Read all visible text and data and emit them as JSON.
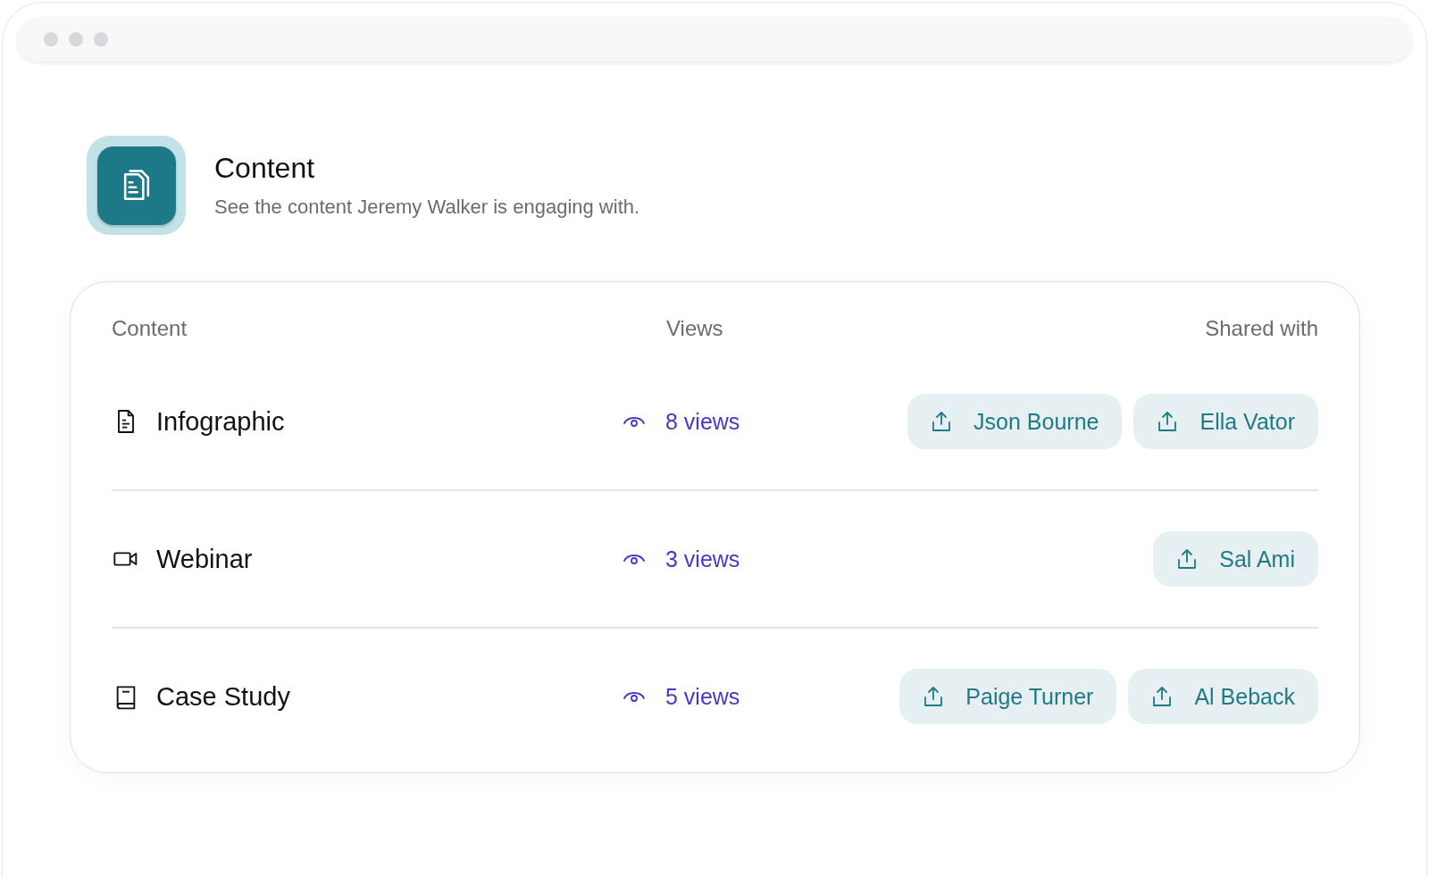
{
  "header": {
    "title": "Content",
    "subtitle": "See the content Jeremy Walker is engaging with."
  },
  "table": {
    "columns": [
      "Content",
      "Views",
      "Shared with"
    ],
    "rows": [
      {
        "kind": "document",
        "name": "Infographic",
        "views": "8 views",
        "shared_with": [
          "Json Bourne",
          "Ella Vator"
        ]
      },
      {
        "kind": "video",
        "name": "Webinar",
        "views": "3 views",
        "shared_with": [
          "Sal Ami"
        ]
      },
      {
        "kind": "book",
        "name": "Case Study",
        "views": "5 views",
        "shared_with": [
          "Paige Turner",
          "Al Beback"
        ]
      }
    ]
  }
}
